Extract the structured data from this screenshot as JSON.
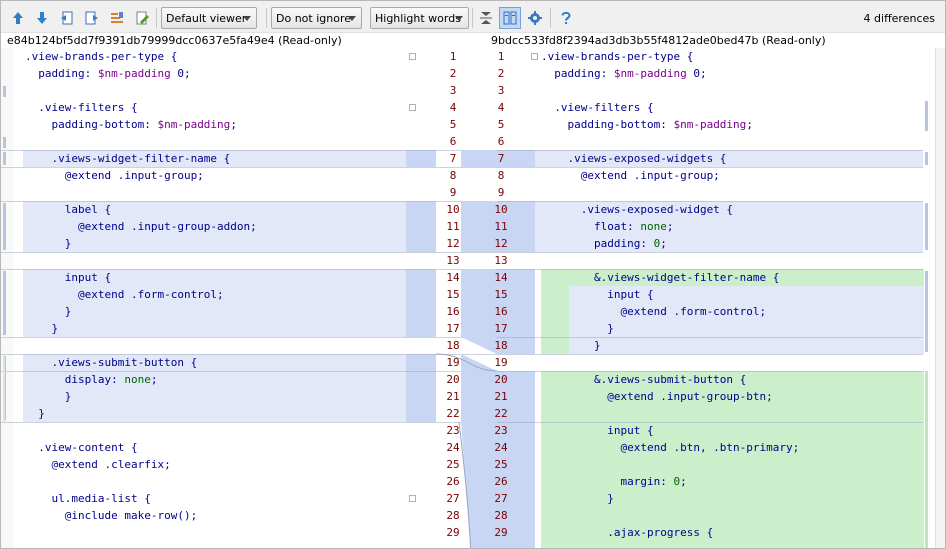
{
  "toolbar": {
    "buttons": [
      "arrow-up-icon",
      "arrow-down-icon",
      "prev-file-icon",
      "next-file-icon",
      "apply-changes-icon",
      "edit-source-icon"
    ],
    "viewer": "Default viewer",
    "ignore": "Do not ignore",
    "highlight": "Highlight words",
    "diff_count": "4 differences"
  },
  "left_header": "e84b124bf5dd7f9391db79999dcc0637e5fa49e4 (Read-only)",
  "right_header": "9bdcc533fd8f2394ad3db3b55f4812ade0bed47b (Read-only)",
  "colors": {
    "changed": "#e2e8f8",
    "changed_gutter": "#c8d6f4",
    "inserted": "#cbeecb",
    "line_number": "#7a0000",
    "key": "#00008b",
    "value": "#006400",
    "variable": "#7b0090"
  },
  "left_lines": [
    [
      {
        "t": ".view-brands-per-type {",
        "c": "k"
      }
    ],
    [
      {
        "t": "  padding: ",
        "c": "k"
      },
      {
        "t": "$nm-padding",
        "c": "v"
      },
      {
        "t": " 0;",
        "c": "k"
      }
    ],
    [],
    [
      {
        "t": "  .view-filters {",
        "c": "k"
      }
    ],
    [
      {
        "t": "    padding-bottom: ",
        "c": "k"
      },
      {
        "t": "$nm-padding",
        "c": "v"
      },
      {
        "t": ";",
        "c": "k"
      }
    ],
    [],
    [
      {
        "t": "    .views-widget-filter-name {",
        "c": "k"
      }
    ],
    [
      {
        "t": "      @extend .input-group;",
        "c": "k"
      }
    ],
    [],
    [
      {
        "t": "      label {",
        "c": "k"
      }
    ],
    [
      {
        "t": "        @extend .input-group-addon;",
        "c": "k"
      }
    ],
    [
      {
        "t": "      }",
        "c": "k"
      }
    ],
    [],
    [
      {
        "t": "      input {",
        "c": "k"
      }
    ],
    [
      {
        "t": "        @extend .form-control;",
        "c": "k"
      }
    ],
    [
      {
        "t": "      }",
        "c": "k"
      }
    ],
    [
      {
        "t": "    }",
        "c": "k"
      }
    ],
    [],
    [
      {
        "t": "    .views-submit-button {",
        "c": "k"
      }
    ],
    [
      {
        "t": "      display: ",
        "c": "k"
      },
      {
        "t": "none",
        "c": "g"
      },
      {
        "t": ";",
        "c": "k"
      }
    ],
    [
      {
        "t": "      }",
        "c": "k"
      }
    ],
    [
      {
        "t": "  }",
        "c": "k"
      }
    ],
    [],
    [
      {
        "t": "  .view-content {",
        "c": "k"
      }
    ],
    [
      {
        "t": "    @extend .clearfix;",
        "c": "k"
      }
    ],
    [],
    [
      {
        "t": "    ul.media-list {",
        "c": "k"
      }
    ],
    [
      {
        "t": "      @include make-row();",
        "c": "k"
      }
    ]
  ],
  "right_lines": [
    [
      {
        "t": ".view-brands-per-type {",
        "c": "k"
      }
    ],
    [
      {
        "t": "  padding: ",
        "c": "k"
      },
      {
        "t": "$nm-padding",
        "c": "v"
      },
      {
        "t": " 0;",
        "c": "k"
      }
    ],
    [],
    [
      {
        "t": "  .view-filters {",
        "c": "k"
      }
    ],
    [
      {
        "t": "    padding-bottom: ",
        "c": "k"
      },
      {
        "t": "$nm-padding",
        "c": "v"
      },
      {
        "t": ";",
        "c": "k"
      }
    ],
    [],
    [
      {
        "t": "    .views-exposed-widgets {",
        "c": "k"
      }
    ],
    [
      {
        "t": "      @extend .input-group;",
        "c": "k"
      }
    ],
    [],
    [
      {
        "t": "      .views-exposed-widget {",
        "c": "k"
      }
    ],
    [
      {
        "t": "        float: ",
        "c": "k"
      },
      {
        "t": "none",
        "c": "g"
      },
      {
        "t": ";",
        "c": "k"
      }
    ],
    [
      {
        "t": "        padding: ",
        "c": "k"
      },
      {
        "t": "0",
        "c": "g"
      },
      {
        "t": ";",
        "c": "k"
      }
    ],
    [],
    [
      {
        "t": "        &.views-widget-filter-name {",
        "c": "k"
      }
    ],
    [
      {
        "t": "          input {",
        "c": "k"
      }
    ],
    [
      {
        "t": "            @extend .form-control;",
        "c": "k"
      }
    ],
    [
      {
        "t": "          }",
        "c": "k"
      }
    ],
    [
      {
        "t": "        }",
        "c": "k"
      }
    ],
    [],
    [
      {
        "t": "        &.views-submit-button {",
        "c": "k"
      }
    ],
    [
      {
        "t": "          @extend .input-group-btn;",
        "c": "k"
      }
    ],
    [],
    [
      {
        "t": "          input {",
        "c": "k"
      }
    ],
    [
      {
        "t": "            @extend .btn, .btn-primary;",
        "c": "k"
      }
    ],
    [],
    [
      {
        "t": "            margin: ",
        "c": "k"
      },
      {
        "t": "0",
        "c": "g"
      },
      {
        "t": ";",
        "c": "k"
      }
    ],
    [
      {
        "t": "          }",
        "c": "k"
      }
    ],
    [],
    [
      {
        "t": "          .ajax-progress {",
        "c": "k"
      }
    ]
  ],
  "left_numbers": [
    "1",
    "2",
    "3",
    "4",
    "5",
    "6",
    "7",
    "8",
    "9",
    "10",
    "11",
    "12",
    "13",
    "14",
    "15",
    "16",
    "17",
    "18",
    "19",
    "20",
    "21",
    "22",
    "23",
    "24",
    "25",
    "26",
    "27",
    "28",
    "29"
  ],
  "right_numbers": [
    "1",
    "2",
    "3",
    "4",
    "5",
    "6",
    "7",
    "8",
    "9",
    "10",
    "11",
    "12",
    "13",
    "14",
    "15",
    "16",
    "17",
    "18",
    "19",
    "20",
    "21",
    "22",
    "23",
    "24",
    "25",
    "26",
    "27",
    "28",
    "29"
  ]
}
